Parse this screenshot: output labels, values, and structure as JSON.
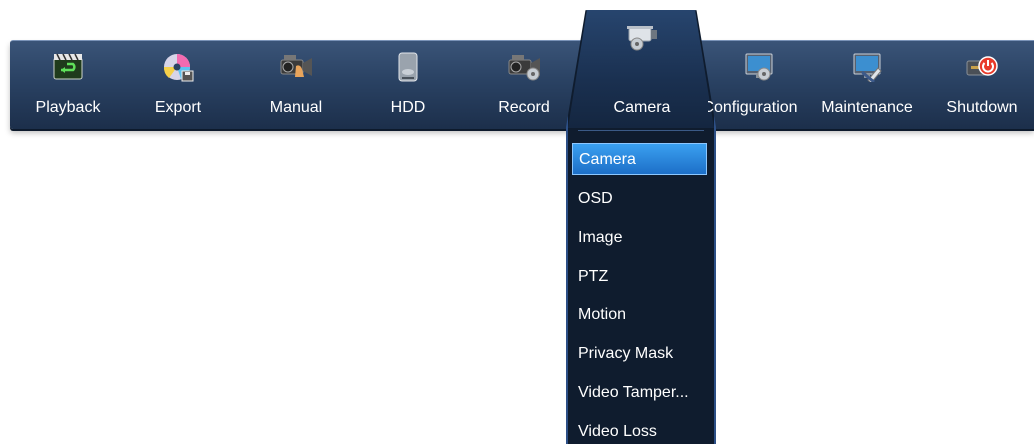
{
  "toolbar": {
    "items": [
      {
        "label": "Playback",
        "icon": "playback-icon"
      },
      {
        "label": "Export",
        "icon": "export-disc-icon"
      },
      {
        "label": "Manual",
        "icon": "manual-record-icon"
      },
      {
        "label": "HDD",
        "icon": "hdd-icon"
      },
      {
        "label": "Record",
        "icon": "record-camera-icon"
      },
      {
        "label": "Camera",
        "icon": "camera-icon",
        "active": true
      },
      {
        "label": "Configuration",
        "icon": "configuration-monitor-icon"
      },
      {
        "label": "Maintenance",
        "icon": "maintenance-monitor-icon"
      },
      {
        "label": "Shutdown",
        "icon": "shutdown-icon"
      }
    ]
  },
  "camera_submenu": {
    "items": [
      {
        "label": "Camera",
        "selected": true
      },
      {
        "label": "OSD"
      },
      {
        "label": "Image"
      },
      {
        "label": "PTZ"
      },
      {
        "label": "Motion"
      },
      {
        "label": "Privacy Mask"
      },
      {
        "label": "Video Tamper..."
      },
      {
        "label": "Video Loss"
      }
    ]
  },
  "colors": {
    "bar": "#2a4263",
    "active_panel": "#0f1c2e",
    "selection": "#2a86dc",
    "shutdown_red": "#e83a2a"
  }
}
